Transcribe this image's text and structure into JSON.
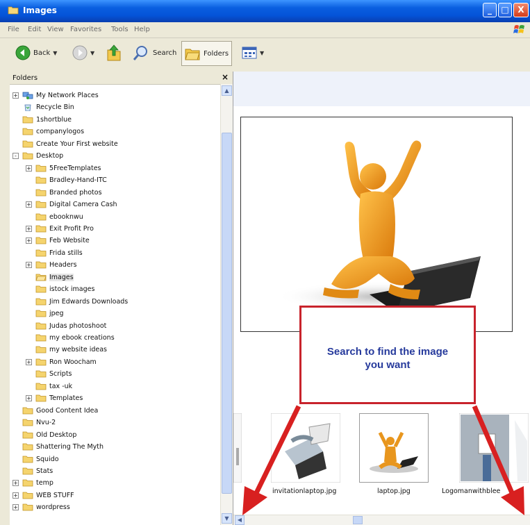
{
  "window": {
    "title": "Images",
    "minimize_label": "_",
    "maximize_label": "□",
    "close_label": "X"
  },
  "menu": [
    "File",
    "Edit",
    "View",
    "Favorites",
    "Tools",
    "Help"
  ],
  "toolbar": {
    "back_label": "Back",
    "search_label": "Search",
    "folders_label": "Folders"
  },
  "folders_pane": {
    "title": "Folders",
    "close_label": "×",
    "items": [
      {
        "label": "My Network Places",
        "depth": 0,
        "expander": "+",
        "icon": "network-places-icon"
      },
      {
        "label": "Recycle Bin",
        "depth": 0,
        "expander": "",
        "icon": "recycle-bin-icon"
      },
      {
        "label": "1shortblue",
        "depth": 0,
        "expander": "",
        "icon": "folder-icon"
      },
      {
        "label": "companylogos",
        "depth": 0,
        "expander": "",
        "icon": "folder-icon"
      },
      {
        "label": "Create Your First website",
        "depth": 0,
        "expander": "",
        "icon": "folder-icon"
      },
      {
        "label": "Desktop",
        "depth": 0,
        "expander": "-",
        "icon": "folder-icon"
      },
      {
        "label": "5FreeTemplates",
        "depth": 1,
        "expander": "+",
        "icon": "folder-icon"
      },
      {
        "label": "Bradley-Hand-ITC",
        "depth": 1,
        "expander": "",
        "icon": "folder-icon"
      },
      {
        "label": "Branded photos",
        "depth": 1,
        "expander": "",
        "icon": "folder-icon"
      },
      {
        "label": "Digital Camera Cash",
        "depth": 1,
        "expander": "+",
        "icon": "folder-icon"
      },
      {
        "label": "ebooknwu",
        "depth": 1,
        "expander": "",
        "icon": "folder-icon"
      },
      {
        "label": "Exit Profit Pro",
        "depth": 1,
        "expander": "+",
        "icon": "folder-icon"
      },
      {
        "label": "Feb Website",
        "depth": 1,
        "expander": "+",
        "icon": "folder-icon"
      },
      {
        "label": "Frida stills",
        "depth": 1,
        "expander": "",
        "icon": "folder-icon"
      },
      {
        "label": "Headers",
        "depth": 1,
        "expander": "+",
        "icon": "folder-icon"
      },
      {
        "label": "Images",
        "depth": 1,
        "expander": "",
        "icon": "folder-open-icon",
        "selected": true
      },
      {
        "label": "istock images",
        "depth": 1,
        "expander": "",
        "icon": "folder-icon"
      },
      {
        "label": "Jim Edwards Downloads",
        "depth": 1,
        "expander": "",
        "icon": "folder-icon"
      },
      {
        "label": "jpeg",
        "depth": 1,
        "expander": "",
        "icon": "folder-icon"
      },
      {
        "label": "Judas photoshoot",
        "depth": 1,
        "expander": "",
        "icon": "folder-icon"
      },
      {
        "label": "my ebook creations",
        "depth": 1,
        "expander": "",
        "icon": "folder-icon"
      },
      {
        "label": "my website ideas",
        "depth": 1,
        "expander": "",
        "icon": "folder-icon"
      },
      {
        "label": "Ron Woocham",
        "depth": 1,
        "expander": "+",
        "icon": "folder-icon"
      },
      {
        "label": "Scripts",
        "depth": 1,
        "expander": "",
        "icon": "folder-icon"
      },
      {
        "label": "tax -uk",
        "depth": 1,
        "expander": "",
        "icon": "folder-icon"
      },
      {
        "label": "Templates",
        "depth": 1,
        "expander": "+",
        "icon": "folder-icon"
      },
      {
        "label": "Good Content Idea",
        "depth": 0,
        "expander": "",
        "icon": "folder-icon"
      },
      {
        "label": "Nvu-2",
        "depth": 0,
        "expander": "",
        "icon": "folder-icon"
      },
      {
        "label": "Old Desktop",
        "depth": 0,
        "expander": "",
        "icon": "folder-icon"
      },
      {
        "label": "Shattering The Myth",
        "depth": 0,
        "expander": "",
        "icon": "folder-icon"
      },
      {
        "label": "Squido",
        "depth": 0,
        "expander": "",
        "icon": "folder-icon"
      },
      {
        "label": "Stats",
        "depth": 0,
        "expander": "",
        "icon": "folder-icon"
      },
      {
        "label": "temp",
        "depth": 0,
        "expander": "+",
        "icon": "folder-icon"
      },
      {
        "label": "WEB STUFF",
        "depth": 0,
        "expander": "+",
        "icon": "folder-icon"
      },
      {
        "label": "wordpress",
        "depth": 0,
        "expander": "+",
        "icon": "folder-icon"
      }
    ]
  },
  "callout": {
    "text_line1": "Search to find the image",
    "text_line2": "you want"
  },
  "thumbnails": [
    {
      "caption": "invitationlaptop.jpg"
    },
    {
      "caption": "laptop.jpg"
    },
    {
      "caption": "Logomanwithblee"
    }
  ],
  "colors": {
    "titlebar": "#0453d8",
    "callout_border": "#c8232c",
    "callout_text": "#263a9c",
    "arrow": "#d82020",
    "figure": "#f0a020"
  }
}
